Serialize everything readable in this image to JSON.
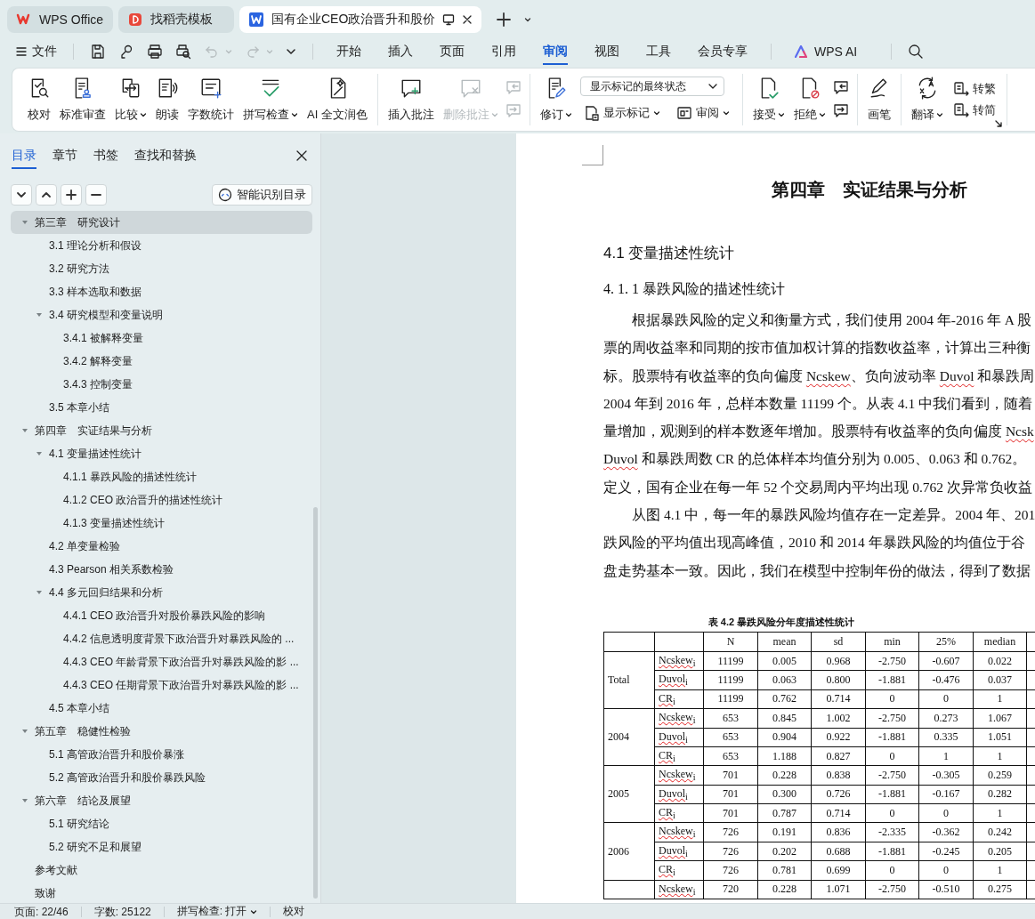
{
  "title_tabs": [
    {
      "label": "WPS Office",
      "selected": false
    },
    {
      "label": "找稻壳模板",
      "selected": false
    },
    {
      "label": "国有企业CEO政治晋升和股价",
      "selected": true
    }
  ],
  "file_menu": "文件",
  "quick_access": [
    {
      "disabled": false
    },
    {
      "disabled": false
    },
    {
      "disabled": false
    },
    {
      "disabled": false
    },
    {
      "disabled": true
    },
    {
      "disabled": true
    }
  ],
  "ribbon_tabs": [
    {
      "label": "开始",
      "selected": false
    },
    {
      "label": "插入",
      "selected": false
    },
    {
      "label": "页面",
      "selected": false
    },
    {
      "label": "引用",
      "selected": false
    },
    {
      "label": "审阅",
      "selected": true
    },
    {
      "label": "视图",
      "selected": false
    },
    {
      "label": "工具",
      "selected": false
    },
    {
      "label": "会员专享",
      "selected": false
    }
  ],
  "ai_button": "WPS AI",
  "ribbon": {
    "groups": [
      {
        "items": [
          {
            "kind": "large",
            "label": "校对",
            "dropdown": false,
            "disabled": false
          },
          {
            "kind": "large",
            "label": "标准审查",
            "dropdown": false,
            "disabled": false
          },
          {
            "kind": "large",
            "label": "比较",
            "dropdown": true,
            "disabled": false
          },
          {
            "kind": "large",
            "label": "朗读",
            "dropdown": false,
            "disabled": false
          },
          {
            "kind": "large",
            "label": "字数统计",
            "dropdown": false,
            "disabled": false
          },
          {
            "kind": "large",
            "label": "拼写检查",
            "dropdown": true,
            "disabled": false
          },
          {
            "kind": "large",
            "label": "AI 全文润色",
            "dropdown": false,
            "disabled": false
          }
        ]
      },
      {
        "items": [
          {
            "kind": "large",
            "label": "插入批注",
            "dropdown": false,
            "disabled": false
          },
          {
            "kind": "large",
            "label": "删除批注",
            "dropdown": true,
            "disabled": true
          },
          {
            "kind": "icon_column",
            "disabled": true
          }
        ]
      },
      {
        "items": [
          {
            "kind": "large",
            "label": "修订",
            "dropdown": true,
            "disabled": false
          },
          {
            "kind": "panel",
            "select": "显示标记的最终状态",
            "buttons": [
              {
                "label": "显示标记",
                "dropdown": true
              },
              {
                "label": "审阅",
                "dropdown": true
              }
            ]
          }
        ]
      },
      {
        "items": [
          {
            "kind": "large",
            "label": "接受",
            "dropdown": true,
            "disabled": false
          },
          {
            "kind": "large",
            "label": "拒绝",
            "dropdown": true,
            "disabled": false
          },
          {
            "kind": "icon_column",
            "disabled": false
          }
        ]
      },
      {
        "items": [
          {
            "kind": "large",
            "label": "画笔",
            "dropdown": false,
            "disabled": false
          }
        ]
      },
      {
        "items": [
          {
            "kind": "large",
            "label": "翻译",
            "dropdown": true,
            "disabled": false
          },
          {
            "kind": "column",
            "buttons": [
              {
                "label": "转繁",
                "dropdown": false
              },
              {
                "label": "转简",
                "dropdown": false
              }
            ]
          }
        ]
      }
    ]
  },
  "sidebar": {
    "tabs": [
      {
        "label": "目录",
        "selected": true
      },
      {
        "label": "章节",
        "selected": false
      },
      {
        "label": "书签",
        "selected": false
      },
      {
        "label": "查找和替换",
        "selected": false
      }
    ],
    "smart_button": "智能识别目录",
    "outline": [
      {
        "label": "第三章　研究设计",
        "selected": true,
        "expanded": true,
        "children": [
          {
            "label": "3.1  理论分析和假设",
            "selected": false
          },
          {
            "label": "3.2  研究方法",
            "selected": false
          },
          {
            "label": "3.3  样本选取和数据",
            "selected": false
          },
          {
            "label": "3.4  研究模型和变量说明",
            "selected": false,
            "expanded": true,
            "children": [
              {
                "label": "3.4.1 被解释变量",
                "selected": false
              },
              {
                "label": "3.4.2  解释变量",
                "selected": false
              },
              {
                "label": "3.4.3  控制变量",
                "selected": false
              }
            ]
          },
          {
            "label": "3.5  本章小结",
            "selected": false
          }
        ]
      },
      {
        "label": "第四章　实证结果与分析",
        "selected": false,
        "expanded": true,
        "children": [
          {
            "label": "4.1  变量描述性统计",
            "selected": false,
            "expanded": true,
            "children": [
              {
                "label": "4.1.1  暴跌风险的描述性统计",
                "selected": false
              },
              {
                "label": "4.1.2 CEO 政治晋升的描述性统计",
                "selected": false
              },
              {
                "label": "4.1.3  变量描述性统计",
                "selected": false
              }
            ]
          },
          {
            "label": "4.2  单变量检验",
            "selected": false
          },
          {
            "label": "4.3 Pearson 相关系数检验",
            "selected": false
          },
          {
            "label": "4.4  多元回归结果和分析",
            "selected": false,
            "expanded": true,
            "children": [
              {
                "label": "4.4.1 CEO 政治晋升对股价暴跌风险的影响",
                "selected": false
              },
              {
                "label": "4.4.2  信息透明度背景下政治晋升对暴跌风险的 ...",
                "selected": false
              },
              {
                "label": "4.4.3 CEO 年龄背景下政治晋升对暴跌风险的影 ...",
                "selected": false
              },
              {
                "label": "4.4.3 CEO 任期背景下政治晋升对暴跌风险的影 ...",
                "selected": false
              }
            ]
          },
          {
            "label": "4.5  本章小结",
            "selected": false
          }
        ]
      },
      {
        "label": "第五章　稳健性检验",
        "selected": false,
        "expanded": true,
        "children": [
          {
            "label": "5.1  高管政治晋升和股价暴涨",
            "selected": false
          },
          {
            "label": "5.2  高管政治晋升和股价暴跌风险",
            "selected": false
          }
        ]
      },
      {
        "label": "第六章　结论及展望",
        "selected": false,
        "expanded": true,
        "children": [
          {
            "label": "5.1  研究结论",
            "selected": false
          },
          {
            "label": "5.2  研究不足和展望",
            "selected": false
          }
        ]
      },
      {
        "label": "参考文献",
        "selected": false
      },
      {
        "label": "致谢",
        "selected": false
      }
    ]
  },
  "document": {
    "chapter_title": "第四章　实证结果与分析",
    "section_title": "4.1  变量描述性统计",
    "subsection_title": "4. 1. 1  暴跌风险的描述性统计",
    "paragraphs": [
      {
        "lines": [
          [
            {
              "text": "根据暴跌风险的定义和衡量方式，我们使用 2004 年-2016 年 A 股",
              "spell_error": false
            }
          ],
          [
            {
              "text": "票的周收益率和同期的按市值加权计算的指数收益率，计算出三种衡",
              "spell_error": false
            }
          ],
          [
            {
              "text": "标。股票特有收益率的负向偏度 ",
              "spell_error": false
            },
            {
              "text": "Ncskew",
              "spell_error": true
            },
            {
              "text": "、负向波动率 ",
              "spell_error": false
            },
            {
              "text": "Duvol",
              "spell_error": true
            },
            {
              "text": " 和暴跌周",
              "spell_error": false
            }
          ],
          [
            {
              "text": "2004 年到 2016 年，总样本数量 11199 个。从表 4.1 中我们看到，随着",
              "spell_error": false
            }
          ],
          [
            {
              "text": "量增加，观测到的样本数逐年增加。股票特有收益率的负向偏度 ",
              "spell_error": false
            },
            {
              "text": "Ncsk",
              "spell_error": true
            }
          ],
          [
            {
              "text": "Duvol",
              "spell_error": true
            },
            {
              "text": " 和暴跌周数 CR 的总体样本均值分别为 0.005、0.063 和 0.762。",
              "spell_error": false
            }
          ],
          [
            {
              "text": "定义，国有企业在每一年 52 个交易周内平均出现 0.762 次异常负收益",
              "spell_error": false
            }
          ]
        ]
      },
      {
        "lines": [
          [
            {
              "text": "从图 4.1 中，每一年的暴跌风险均值存在一定差异。2004 年、201",
              "spell_error": false
            }
          ],
          [
            {
              "text": "跌风险的平均值出现高峰值，2010 和 2014 年暴跌风险的均值位于谷",
              "spell_error": false
            }
          ],
          [
            {
              "text": "盘走势基本一致。因此，我们在模型中控制年份的做法，得到了数据",
              "spell_error": false
            }
          ]
        ]
      }
    ],
    "table": {
      "caption": "表 4.2 暴跌风险分年度描述性统计",
      "columns": [
        "N",
        "mean",
        "sd",
        "min",
        "25%",
        "median"
      ],
      "groups": [
        {
          "label": "Total",
          "rows": [
            {
              "variable": "Ncskew$_{i}$",
              "values": [
                "11199",
                "0.005",
                "0.968",
                "-2.750",
                "-0.607",
                "0.022"
              ]
            },
            {
              "variable": "Duvol$_{i}$",
              "values": [
                "11199",
                "0.063",
                "0.800",
                "-1.881",
                "-0.476",
                "0.037"
              ]
            },
            {
              "variable": "CR$_{i}$",
              "values": [
                "11199",
                "0.762",
                "0.714",
                "0",
                "0",
                "1"
              ]
            }
          ]
        },
        {
          "label": "2004",
          "rows": [
            {
              "variable": "Ncskew$_{i}$",
              "values": [
                "653",
                "0.845",
                "1.002",
                "-2.750",
                "0.273",
                "1.067"
              ]
            },
            {
              "variable": "Duvol$_{i}$",
              "values": [
                "653",
                "0.904",
                "0.922",
                "-1.881",
                "0.335",
                "1.051"
              ]
            },
            {
              "variable": "CR$_{i}$",
              "values": [
                "653",
                "1.188",
                "0.827",
                "0",
                "1",
                "1"
              ]
            }
          ]
        },
        {
          "label": "2005",
          "rows": [
            {
              "variable": "Ncskew$_{i}$",
              "values": [
                "701",
                "0.228",
                "0.838",
                "-2.750",
                "-0.305",
                "0.259"
              ]
            },
            {
              "variable": "Duvol$_{i}$",
              "values": [
                "701",
                "0.300",
                "0.726",
                "-1.881",
                "-0.167",
                "0.282"
              ]
            },
            {
              "variable": "CR$_{i}$",
              "values": [
                "701",
                "0.787",
                "0.714",
                "0",
                "0",
                "1"
              ]
            }
          ]
        },
        {
          "label": "2006",
          "rows": [
            {
              "variable": "Ncskew$_{i}$",
              "values": [
                "726",
                "0.191",
                "0.836",
                "-2.335",
                "-0.362",
                "0.242"
              ]
            },
            {
              "variable": "Duvol$_{i}$",
              "values": [
                "726",
                "0.202",
                "0.688",
                "-1.881",
                "-0.245",
                "0.205"
              ]
            },
            {
              "variable": "CR$_{i}$",
              "values": [
                "726",
                "0.781",
                "0.699",
                "0",
                "0",
                "1"
              ]
            }
          ]
        },
        {
          "rows": [
            {
              "variable": "Ncskew$_{i}$",
              "values": [
                "720",
                "0.228",
                "1.071",
                "-2.750",
                "-0.510",
                "0.275"
              ]
            }
          ]
        }
      ]
    }
  },
  "status_bar": {
    "page": "页面: 22/46",
    "words": "字数: 25122",
    "spell_check": "拼写检查: 打开",
    "proofread": "校对"
  }
}
